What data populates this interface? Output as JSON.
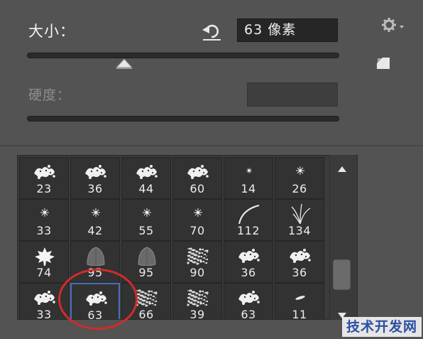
{
  "size": {
    "label": "大小：",
    "value": "63 像素"
  },
  "hardness": {
    "label": "硬度：",
    "value": ""
  },
  "colors": {
    "accent_selected": "#4d6fb6",
    "annotation_circle": "#d42a2a"
  },
  "brushes": [
    {
      "size": "23",
      "shape": "scatter-leaf"
    },
    {
      "size": "36",
      "shape": "scatter-leaf"
    },
    {
      "size": "44",
      "shape": "scatter-leaf"
    },
    {
      "size": "60",
      "shape": "scatter-leaf"
    },
    {
      "size": "14",
      "shape": "soft-dot"
    },
    {
      "size": "26",
      "shape": "star-dot"
    },
    {
      "size": "33",
      "shape": "star-dot"
    },
    {
      "size": "42",
      "shape": "star-dot"
    },
    {
      "size": "55",
      "shape": "star-dot"
    },
    {
      "size": "70",
      "shape": "star-dot"
    },
    {
      "size": "112",
      "shape": "curve-stroke"
    },
    {
      "size": "134",
      "shape": "grass"
    },
    {
      "size": "74",
      "shape": "maple-leaf"
    },
    {
      "size": "95",
      "shape": "leaf"
    },
    {
      "size": "95",
      "shape": "leaf"
    },
    {
      "size": "90",
      "shape": "spatter"
    },
    {
      "size": "36",
      "shape": "scatter-leaf"
    },
    {
      "size": "36",
      "shape": "scatter-leaf"
    },
    {
      "size": "33",
      "shape": "scatter-leaf"
    },
    {
      "size": "63",
      "shape": "scatter-leaf",
      "selected": true
    },
    {
      "size": "66",
      "shape": "spatter"
    },
    {
      "size": "39",
      "shape": "spatter"
    },
    {
      "size": "63",
      "shape": "scatter-leaf"
    },
    {
      "size": "11",
      "shape": "oval"
    }
  ],
  "watermark": "技术开发网"
}
